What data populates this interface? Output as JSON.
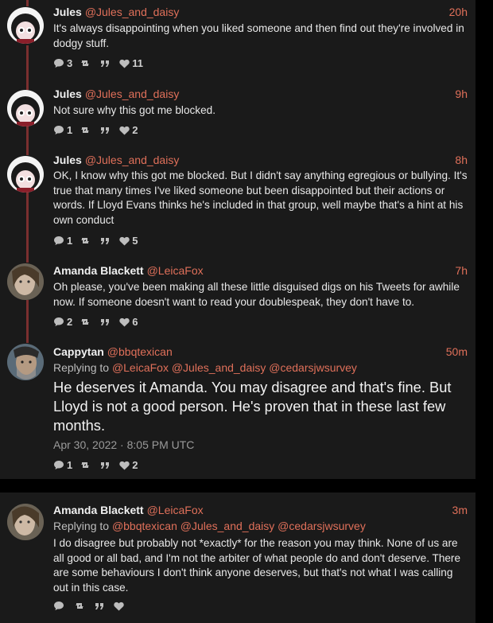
{
  "tweets": [
    {
      "name": "Jules",
      "handle": "@Jules_and_daisy",
      "time": "20h",
      "text": "It's always disappointing when you liked someone and then find out they're involved in dodgy stuff.",
      "replies": "3",
      "retweets": "",
      "likes": "11"
    },
    {
      "name": "Jules",
      "handle": "@Jules_and_daisy",
      "time": "9h",
      "text": "Not sure why this got me blocked.",
      "replies": "1",
      "retweets": "",
      "likes": "2"
    },
    {
      "name": "Jules",
      "handle": "@Jules_and_daisy",
      "time": "8h",
      "text": "OK, I know why this got me blocked. But I didn't say anything egregious or bullying. It's true that many times I've liked someone but been disappointed but their actions or words. If Lloyd Evans thinks he's included in that group, well maybe that's a hint at his own conduct",
      "replies": "1",
      "retweets": "",
      "likes": "5"
    },
    {
      "name": "Amanda Blackett",
      "handle": "@LeicaFox",
      "time": "7h",
      "text": "Oh please, you've been making all these little disguised digs on his Tweets for awhile now. If someone doesn't want to read your doublespeak, they don't have to.",
      "replies": "2",
      "retweets": "",
      "likes": "6"
    },
    {
      "name": "Cappytan",
      "handle": "@bbqtexican",
      "time": "50m",
      "replying_prefix": "Replying to",
      "replying_to": "@LeicaFox @Jules_and_daisy @cedarsjwsurvey",
      "text": "He deserves it Amanda. You may disagree and that's fine. But Lloyd is not a good person. He's proven that in these last few months.",
      "date": "Apr 30, 2022 · 8:05 PM UTC",
      "replies": "1",
      "retweets": "",
      "likes": "2"
    },
    {
      "name": "Amanda Blackett",
      "handle": "@LeicaFox",
      "time": "3m",
      "replying_prefix": "Replying to",
      "replying_to": "@bbqtexican @Jules_and_daisy @cedarsjwsurvey",
      "text": "I do disagree but probably not *exactly* for the reason you may think. None of us are all good or all bad, and I'm not the arbiter of what people do and don't deserve. There are some behaviours I don't think anyone deserves, but that's not what I was calling out in this case.",
      "replies": "",
      "retweets": "",
      "likes": ""
    }
  ],
  "colors": {
    "accent": "#e0705a",
    "thread_line": "#7a2f2f",
    "panel": "#1a1a1a",
    "background": "#000000"
  },
  "icons": [
    "comment-icon",
    "retweet-icon",
    "quote-icon",
    "heart-icon"
  ]
}
